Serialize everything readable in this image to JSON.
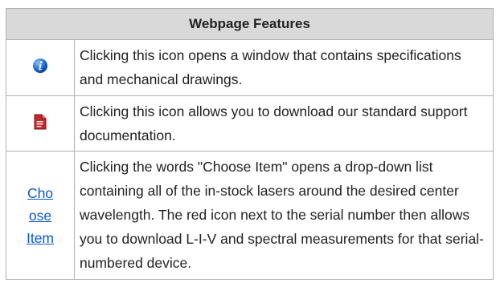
{
  "table": {
    "title": "Webpage Features",
    "rows": [
      {
        "icon": "info-icon",
        "description": "Clicking this icon opens a window that contains specifications and mechanical drawings."
      },
      {
        "icon": "pdf-document-icon",
        "description": "Clicking this icon allows you to download our standard support documentation."
      },
      {
        "link_text": "Choose Item",
        "description": "Clicking the words \"Choose Item\" opens a drop-down list containing all of the in-stock lasers around the desired center wavelength. The red icon next to the serial number then allows you to download L-I-V and spectral measurements for that serial-numbered device."
      }
    ]
  },
  "colors": {
    "header_bg": "#d9d9d9",
    "border": "#b0b0b0",
    "link": "#0b57d0",
    "info_icon": "#1e6fd6",
    "pdf_icon": "#c62828"
  }
}
